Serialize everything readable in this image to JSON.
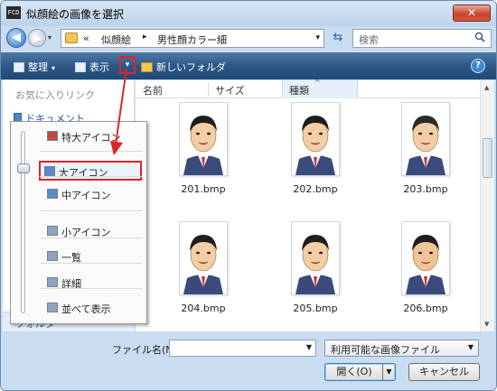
{
  "window": {
    "title": "似顔絵の画像を選択",
    "app_icon_text": "FCD",
    "close_label": "✕"
  },
  "address": {
    "back_glyph": "◀",
    "forward_glyph": "▶",
    "chevron": "«",
    "segment1": "似顔絵",
    "separator": "▸",
    "segment2": "男性顔カラー細",
    "drop": "▾",
    "refresh_glyph": "⇆"
  },
  "search": {
    "placeholder": "検索"
  },
  "toolbar": {
    "organize_label": "整理",
    "views_label": "表示",
    "views_dropdown": "▾",
    "new_folder_label": "新しいフォルダ",
    "help_label": "?",
    "arrow": "▾"
  },
  "navpane": {
    "favorites_label": "お気に入りリンク",
    "documents_label": "ドキュメント",
    "folders_label": "フォルダ",
    "folders_chevron": "▲"
  },
  "columns": [
    {
      "label": "名前"
    },
    {
      "label": "サイズ"
    },
    {
      "label": "種類"
    }
  ],
  "sort_glyph": "^",
  "files": [
    {
      "name": "201.bmp"
    },
    {
      "name": "202.bmp"
    },
    {
      "name": "203.bmp"
    },
    {
      "name": "204.bmp"
    },
    {
      "name": "205.bmp"
    },
    {
      "name": "206.bmp"
    }
  ],
  "view_menu": {
    "items": [
      {
        "label": "特大アイコン",
        "icon": "extra-large-icons-icon"
      },
      {
        "label": "大アイコン",
        "icon": "large-icons-icon",
        "selected": true
      },
      {
        "label": "中アイコン",
        "icon": "medium-icons-icon"
      },
      {
        "label": "小アイコン",
        "icon": "small-icons-icon"
      },
      {
        "label": "一覧",
        "icon": "list-icon"
      },
      {
        "label": "詳細",
        "icon": "details-icon"
      },
      {
        "label": "並べて表示",
        "icon": "tiles-icon"
      }
    ]
  },
  "bottom": {
    "filename_label": "ファイル名(N):",
    "filename_value": "",
    "filetype_value": "利用可能な画像ファイル",
    "open_label": "開く(O)",
    "cancel_label": "キャンセル"
  },
  "colors": {
    "annotation_red": "#e02424",
    "toolbar_blue": "#2d5886",
    "link_blue": "#2357b0"
  }
}
